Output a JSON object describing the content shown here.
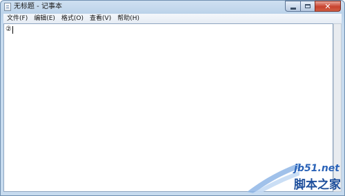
{
  "window": {
    "title": "无标题 - 记事本",
    "icon": "notepad-icon",
    "caption_icons": [
      "minimize-icon",
      "maximize-icon",
      "close-icon"
    ],
    "close_glyph": "✕"
  },
  "menu": {
    "items": [
      {
        "label": "文件(F)"
      },
      {
        "label": "编辑(E)"
      },
      {
        "label": "格式(O)"
      },
      {
        "label": "查看(V)"
      },
      {
        "label": "帮助(H)"
      }
    ]
  },
  "editor": {
    "content": "②"
  },
  "watermark": {
    "url": "jb51.net",
    "site_name": "脚本之家"
  },
  "colors": {
    "title_bar": "#c7dbef",
    "close_button": "#c8432f",
    "watermark": "#1e4f9c"
  }
}
